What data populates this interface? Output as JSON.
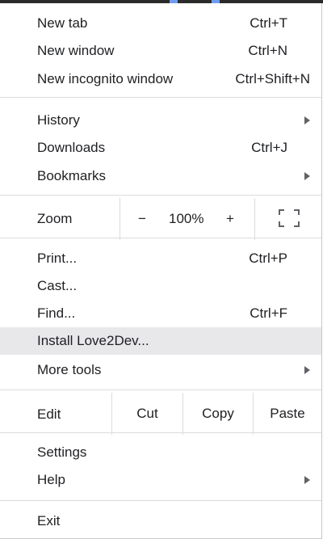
{
  "menu": {
    "new_tab": {
      "label": "New tab",
      "shortcut": "Ctrl+T"
    },
    "new_window": {
      "label": "New window",
      "shortcut": "Ctrl+N"
    },
    "new_incognito": {
      "label": "New incognito window",
      "shortcut": "Ctrl+Shift+N"
    },
    "history": {
      "label": "History"
    },
    "downloads": {
      "label": "Downloads",
      "shortcut": "Ctrl+J"
    },
    "bookmarks": {
      "label": "Bookmarks"
    },
    "zoom": {
      "label": "Zoom",
      "minus": "−",
      "value": "100%",
      "plus": "+"
    },
    "print": {
      "label": "Print...",
      "shortcut": "Ctrl+P"
    },
    "cast": {
      "label": "Cast..."
    },
    "find": {
      "label": "Find...",
      "shortcut": "Ctrl+F"
    },
    "install": {
      "label": "Install Love2Dev..."
    },
    "more_tools": {
      "label": "More tools"
    },
    "edit": {
      "label": "Edit",
      "cut": "Cut",
      "copy": "Copy",
      "paste": "Paste"
    },
    "settings": {
      "label": "Settings"
    },
    "help": {
      "label": "Help"
    },
    "exit": {
      "label": "Exit"
    }
  }
}
